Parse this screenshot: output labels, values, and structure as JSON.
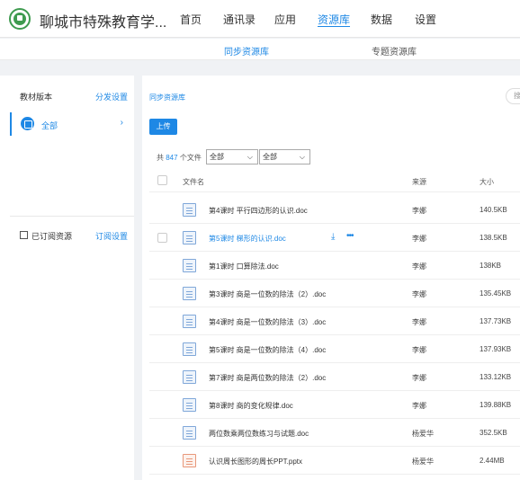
{
  "header": {
    "app_name": "聊城市特殊教育学...",
    "nav": [
      "首页",
      "通讯录",
      "应用",
      "资源库",
      "数据",
      "设置"
    ],
    "active_nav": "资源库"
  },
  "subnav": {
    "tabs": [
      "同步资源库",
      "专题资源库"
    ],
    "active": "同步资源库"
  },
  "sidebar": {
    "textbook_label": "教材版本",
    "distribute_link": "分发设置",
    "all_item": {
      "label": "全部",
      "chevron": "›"
    },
    "subscribed_label": "已订阅资源",
    "subscribe_link": "订阅设置"
  },
  "main": {
    "breadcrumb": "同步资源库",
    "right_pill": "搜",
    "upload_label": "上传",
    "count_prefix": "共",
    "count_value": "847",
    "count_suffix": "个文件",
    "filter1": "全部",
    "filter2": "全部",
    "columns": {
      "name": "文件名",
      "source": "来源",
      "size": "大小"
    },
    "files": [
      {
        "name": "第4课时  平行四边形的认识.doc",
        "source": "李娜",
        "size": "140.5KB",
        "type": "doc"
      },
      {
        "name": "第5课时  梯形的认识.doc",
        "source": "李娜",
        "size": "138.5KB",
        "type": "doc"
      },
      {
        "name": "第1课时  口算除法.doc",
        "source": "李娜",
        "size": "138KB",
        "type": "doc"
      },
      {
        "name": "第3课时  商是一位数的除法（2）.doc",
        "source": "李娜",
        "size": "135.45KB",
        "type": "doc"
      },
      {
        "name": "第4课时  商是一位数的除法（3）.doc",
        "source": "李娜",
        "size": "137.73KB",
        "type": "doc"
      },
      {
        "name": "第5课时  商是一位数的除法（4）.doc",
        "source": "李娜",
        "size": "137.93KB",
        "type": "doc"
      },
      {
        "name": "第7课时  商是两位数的除法（2）.doc",
        "source": "李娜",
        "size": "133.12KB",
        "type": "doc"
      },
      {
        "name": "第8课时  商的变化规律.doc",
        "source": "李娜",
        "size": "139.88KB",
        "type": "doc"
      },
      {
        "name": "两位数乘两位数练习与试题.doc",
        "source": "杨爱华",
        "size": "352.5KB",
        "type": "doc"
      },
      {
        "name": "认识周长图形的周长PPT.pptx",
        "source": "杨爱华",
        "size": "2.44MB",
        "type": "ppt"
      }
    ]
  },
  "colors": {
    "accent": "#1e88e5",
    "logo": "#3e9b4f"
  },
  "icons": [
    "logo-icon",
    "book-icon",
    "subscribe-icon",
    "file-doc-icon",
    "file-ppt-icon",
    "download-icon",
    "more-icon",
    "chevron-right-icon",
    "dropdown-arrow-icon"
  ]
}
